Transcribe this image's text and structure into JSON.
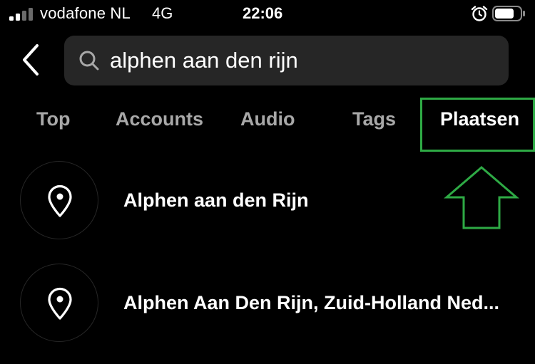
{
  "status_bar": {
    "carrier": "vodafone NL",
    "network": "4G",
    "time": "22:06"
  },
  "search": {
    "query": "alphen aan den rijn"
  },
  "tabs": [
    {
      "label": "Top",
      "active": false
    },
    {
      "label": "Accounts",
      "active": false
    },
    {
      "label": "Audio",
      "active": false
    },
    {
      "label": "Tags",
      "active": false
    },
    {
      "label": "Plaatsen",
      "active": true
    }
  ],
  "results": [
    {
      "title": "Alphen aan den Rijn",
      "icon": "location-pin-icon"
    },
    {
      "title": "Alphen Aan Den Rijn, Zuid-Holland Ned...",
      "icon": "location-pin-icon"
    }
  ],
  "colors": {
    "background": "#000000",
    "search_box": "#262626",
    "tab_inactive": "#a8a8a8",
    "tab_active": "#ffffff",
    "annotation": "#2eaa45"
  }
}
